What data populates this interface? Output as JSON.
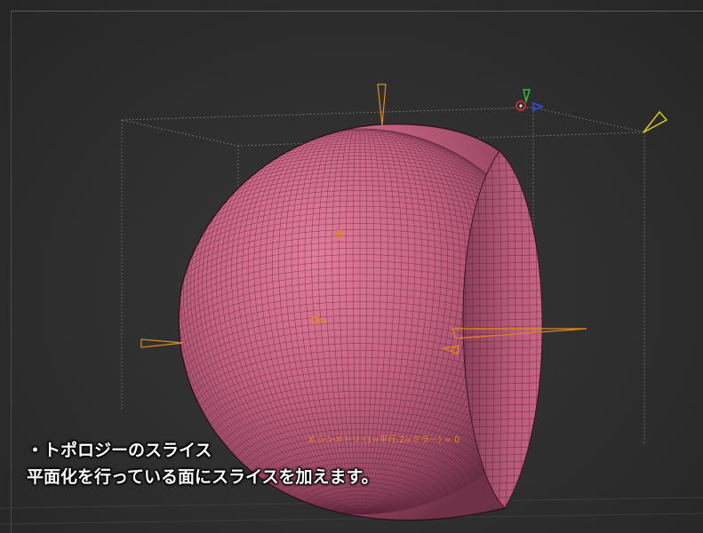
{
  "viewport": {
    "background": "#2b2b2b",
    "mesh_color": "#c86483",
    "gizmo_color": "#e08a1e",
    "light_color": "#d8c81a"
  },
  "overlay": {
    "symmetry_text": "X シンメトリ (1=平行,2=ミラー) = 0"
  },
  "caption": {
    "line1": "・トポロジーのスライス",
    "line2": "平面化を行っている面にスライスを加えます。"
  },
  "icons": [
    "orientation-gizmo-icon",
    "light-cone-icon",
    "pivot-target-icon"
  ]
}
